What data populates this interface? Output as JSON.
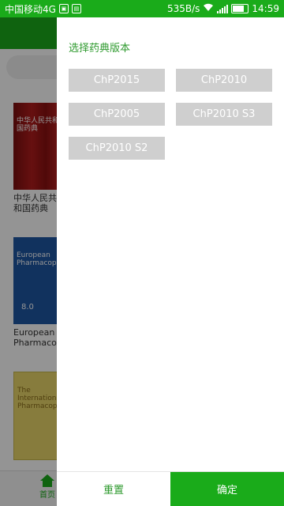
{
  "status_bar": {
    "carrier": "中国移动4G",
    "speed": "535B/s",
    "network": "4G",
    "time": "14:59"
  },
  "background": {
    "books": [
      {
        "title": "中华人民共和国药典",
        "cover_text": "中华人民共和国药典",
        "number": ""
      },
      {
        "title": "European Pharmacopoeia",
        "cover_text": "European Pharmacopoeia",
        "number": "8.0"
      },
      {
        "title": "",
        "cover_text": "The International Pharmacopoeia",
        "number": ""
      }
    ],
    "bottom_tab_home": "首页"
  },
  "drawer": {
    "title": "选择药典版本",
    "options": [
      "ChP2015",
      "ChP2010",
      "ChP2005",
      "ChP2010 S3",
      "ChP2010 S2"
    ],
    "reset_label": "重置",
    "confirm_label": "确定"
  },
  "colors": {
    "accent": "#1aab1a",
    "chip_bg": "#cfcfcf"
  }
}
